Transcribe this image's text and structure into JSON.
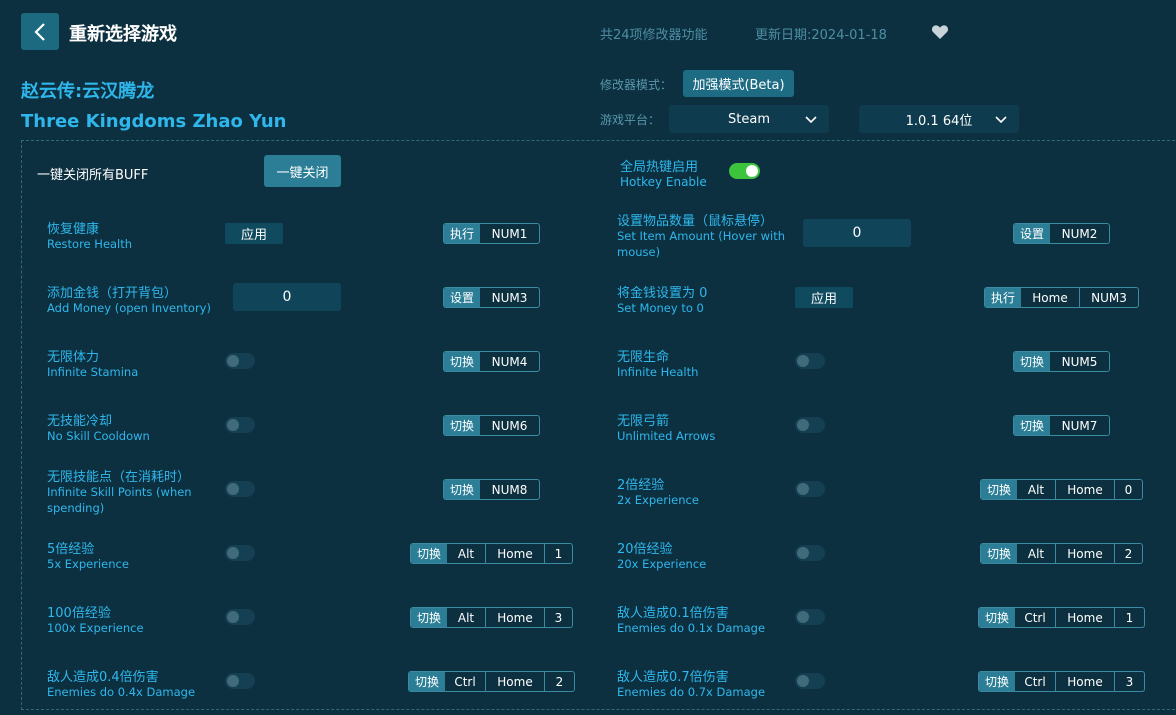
{
  "header": {
    "back_label": "back",
    "title": "重新选择游戏",
    "feature_count": "共24项修改器功能",
    "update_date": "更新日期:2024-01-18"
  },
  "game": {
    "name_cn": "赵云传:云汉腾龙",
    "name_en": "Three Kingdoms Zhao Yun"
  },
  "settings": {
    "mode_label": "修改器模式：",
    "mode_value": "加强模式(Beta)",
    "platform_label": "游戏平台：",
    "platform_value": "Steam",
    "version_value": "1.0.1 64位"
  },
  "global": {
    "close_all_label": "一键关闭所有BUFF",
    "close_all_button": "一键关闭",
    "hotkey_cn": "全局热键启用",
    "hotkey_en": "Hotkey Enable",
    "hotkey_enabled": true
  },
  "cheats": {
    "restore_health": {
      "cn": "恢复健康",
      "en": "Restore Health",
      "control": "应用",
      "action": "执行",
      "keys": [
        "NUM1"
      ]
    },
    "set_item_amount": {
      "cn": "设置物品数量（鼠标悬停）",
      "en": "Set Item Amount (Hover with mouse)",
      "value": "0",
      "action": "设置",
      "keys": [
        "NUM2"
      ]
    },
    "add_money": {
      "cn": "添加金钱（打开背包）",
      "en": "Add Money (open Inventory)",
      "value": "0",
      "action": "设置",
      "keys": [
        "NUM3"
      ]
    },
    "set_money_zero": {
      "cn": "将金钱设置为 0",
      "en": "Set Money to 0",
      "control": "应用",
      "action": "执行",
      "keys": [
        "Home",
        "NUM3"
      ]
    },
    "infinite_stamina": {
      "cn": "无限体力",
      "en": "Infinite Stamina",
      "action": "切换",
      "keys": [
        "NUM4"
      ]
    },
    "infinite_health": {
      "cn": "无限生命",
      "en": "Infinite Health",
      "action": "切换",
      "keys": [
        "NUM5"
      ]
    },
    "no_skill_cooldown": {
      "cn": "无技能冷却",
      "en": "No Skill Cooldown",
      "action": "切换",
      "keys": [
        "NUM6"
      ]
    },
    "unlimited_arrows": {
      "cn": "无限弓箭",
      "en": "Unlimited Arrows",
      "action": "切换",
      "keys": [
        "NUM7"
      ]
    },
    "infinite_skill_points": {
      "cn": "无限技能点（在消耗时）",
      "en": "Infinite Skill Points (when spending)",
      "action": "切换",
      "keys": [
        "NUM8"
      ]
    },
    "exp_2x": {
      "cn": "2倍经验",
      "en": "2x Experience",
      "action": "切换",
      "keys": [
        "Alt",
        "Home",
        "0"
      ]
    },
    "exp_5x": {
      "cn": "5倍经验",
      "en": "5x Experience",
      "action": "切换",
      "keys": [
        "Alt",
        "Home",
        "1"
      ]
    },
    "exp_20x": {
      "cn": "20倍经验",
      "en": "20x Experience",
      "action": "切换",
      "keys": [
        "Alt",
        "Home",
        "2"
      ]
    },
    "exp_100x": {
      "cn": "100倍经验",
      "en": "100x Experience",
      "action": "切换",
      "keys": [
        "Alt",
        "Home",
        "3"
      ]
    },
    "enemy_dmg_01": {
      "cn": "敌人造成0.1倍伤害",
      "en": "Enemies do 0.1x Damage",
      "action": "切换",
      "keys": [
        "Ctrl",
        "Home",
        "1"
      ]
    },
    "enemy_dmg_04": {
      "cn": "敌人造成0.4倍伤害",
      "en": "Enemies do 0.4x Damage",
      "action": "切换",
      "keys": [
        "Ctrl",
        "Home",
        "2"
      ]
    },
    "enemy_dmg_07": {
      "cn": "敌人造成0.7倍伤害",
      "en": "Enemies do 0.7x Damage",
      "action": "切换",
      "keys": [
        "Ctrl",
        "Home",
        "3"
      ]
    }
  },
  "icons": {
    "back": "chevron-left-icon",
    "heart": "heart-icon",
    "dropdown": "chevron-down-icon"
  }
}
